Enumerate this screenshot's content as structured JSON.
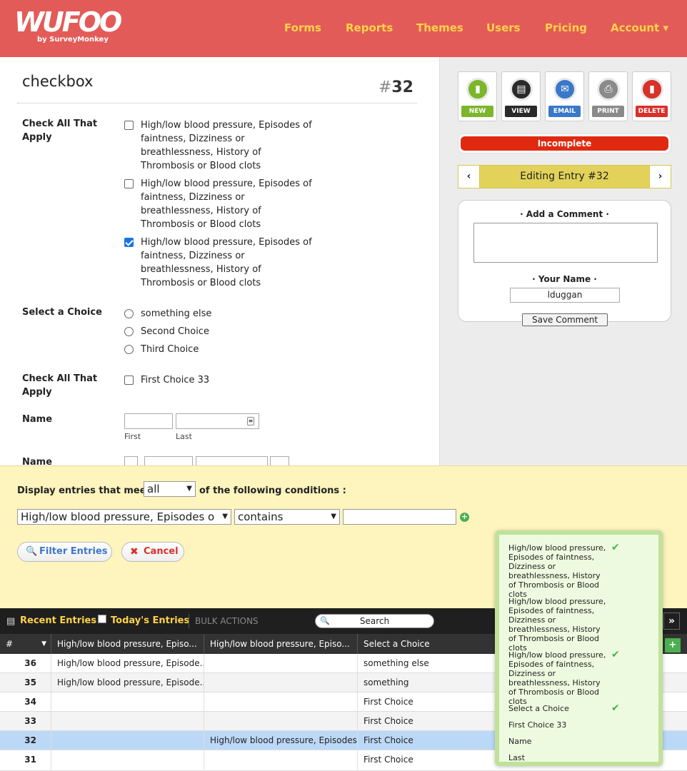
{
  "header": {
    "logo_word": "WUFOO",
    "logo_sub": "by SurveyMonkey",
    "nav": [
      "Forms",
      "Reports",
      "Themes",
      "Users",
      "Pricing",
      "Account ▾"
    ]
  },
  "form": {
    "title": "checkbox",
    "entry_hash": "#",
    "entry_number": "32",
    "fields": {
      "check1_label": "Check All That Apply",
      "check1_options": [
        {
          "text": "High/low blood pressure, Episodes of faintness, Dizziness or breathlessness, History of Thrombosis or Blood clots",
          "checked": false
        },
        {
          "text": "High/low blood pressure, Episodes of faintness, Dizziness or breathlessness, History of Thrombosis or Blood clots",
          "checked": false
        },
        {
          "text": "High/low blood pressure, Episodes of faintness, Dizziness or breathlessness, History of Thrombosis or Blood clots",
          "checked": true
        }
      ],
      "select_label": "Select a Choice",
      "select_options": [
        "something else",
        "Second Choice",
        "Third Choice"
      ],
      "check2_label": "Check All That Apply",
      "check2_options": [
        "First Choice 33"
      ],
      "name_label": "Name",
      "name_first": "First",
      "name_last": "Last",
      "name2_label": "Name"
    }
  },
  "sidebar": {
    "actions": [
      {
        "label": "NEW",
        "icon": "new-doc-icon",
        "color": "#7cb62a"
      },
      {
        "label": "VIEW",
        "icon": "view-doc-icon",
        "color": "#2a2a2a"
      },
      {
        "label": "EMAIL",
        "icon": "email-icon",
        "color": "#3a78c8"
      },
      {
        "label": "PRINT",
        "icon": "print-icon",
        "color": "#8a8a8a"
      },
      {
        "label": "DELETE",
        "icon": "delete-doc-icon",
        "color": "#d8312a"
      }
    ],
    "status": "Incomplete",
    "editing_title": "Editing Entry #32",
    "prev": "‹",
    "next": "›",
    "comment": {
      "add_heading": "· Add a Comment ·",
      "name_heading": "· Your Name ·",
      "name_value": "lduggan",
      "save_label": "Save Comment"
    }
  },
  "filter": {
    "display_prefix": "Display entries that meet",
    "match_value": "all",
    "display_suffix": "of the following conditions :",
    "field_value": "High/low blood pressure, Episodes o",
    "operator_value": "contains",
    "filter_value": "",
    "filter_button": "Filter Entries",
    "cancel_button": "Cancel"
  },
  "entries_bar": {
    "recent": "Recent Entries",
    "today": "Today's Entries",
    "bulk": "BULK ACTIONS",
    "search_placeholder": "Search",
    "expand": "»"
  },
  "table": {
    "headers": [
      "#",
      "High/low blood pressure, Episo...",
      "High/low blood pressure, Episo...",
      "Select a Choice"
    ],
    "rows": [
      {
        "num": "36",
        "c1": "High/low blood pressure, Episode...",
        "c2": "",
        "c3": "something else"
      },
      {
        "num": "35",
        "c1": "High/low blood pressure, Episode...",
        "c2": "",
        "c3": "something"
      },
      {
        "num": "34",
        "c1": "",
        "c2": "",
        "c3": "First Choice"
      },
      {
        "num": "33",
        "c1": "",
        "c2": "",
        "c3": "First Choice"
      },
      {
        "num": "32",
        "c1": "",
        "c2": "High/low blood pressure, Episodes...",
        "c3": "First Choice"
      },
      {
        "num": "31",
        "c1": "",
        "c2": "",
        "c3": "First Choice"
      }
    ],
    "add_column": "+"
  },
  "column_popup": {
    "items": [
      {
        "text": "High/low blood pressure, Episodes of faintness, Dizziness or breathlessness, History of Thrombosis or Blood clots",
        "checked": true
      },
      {
        "text": "High/low blood pressure, Episodes of faintness, Dizziness or breathlessness, History of Thrombosis or Blood clots",
        "checked": false
      },
      {
        "text": "High/low blood pressure, Episodes of faintness, Dizziness or breathlessness, History of Thrombosis or Blood clots",
        "checked": true
      },
      {
        "text": "Select a Choice",
        "checked": true
      },
      {
        "text": "First Choice 33",
        "checked": false
      },
      {
        "text": "Name",
        "checked": false
      },
      {
        "text": "Last",
        "checked": false
      }
    ]
  }
}
